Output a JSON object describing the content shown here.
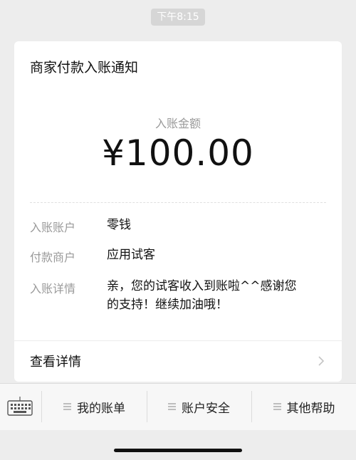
{
  "timestamp": "下午8:15",
  "card": {
    "title": "商家付款入账通知",
    "amount_label": "入账金额",
    "amount": "¥100.00",
    "rows": [
      {
        "label": "入账账户",
        "value": "零钱"
      },
      {
        "label": "付款商户",
        "value": "应用试客"
      },
      {
        "label": "入账详情",
        "value_line1": "亲，您的试客收入到账啦^^感谢您",
        "value_line2": "的支持！继续加油哦！"
      }
    ],
    "detail_link": "查看详情"
  },
  "bottom_menu": {
    "keyboard_icon": "keyboard-icon",
    "items": [
      {
        "label": "我的账单",
        "icon": "menu-lines-icon"
      },
      {
        "label": "账户安全",
        "icon": "menu-lines-icon"
      },
      {
        "label": "其他帮助",
        "icon": "menu-lines-icon"
      }
    ]
  }
}
